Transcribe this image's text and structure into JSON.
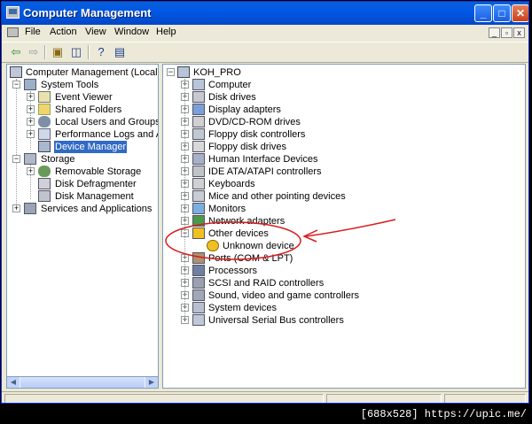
{
  "window": {
    "title": "Computer Management",
    "accent": "#0058e6"
  },
  "menu": {
    "items": [
      "File",
      "Action",
      "View",
      "Window",
      "Help"
    ]
  },
  "toolbar": {
    "buttons": [
      "back-icon",
      "forward-icon",
      "up-folder-icon",
      "show-hide-tree-icon",
      "help-icon",
      "properties-icon"
    ]
  },
  "left_tree": {
    "root": "Computer Management (Local)",
    "system_tools": "System Tools",
    "event_viewer": "Event Viewer",
    "shared_folders": "Shared Folders",
    "local_users": "Local Users and Groups",
    "perf_logs": "Performance Logs and Alerts",
    "device_manager": "Device Manager",
    "storage": "Storage",
    "removable_storage": "Removable Storage",
    "disk_defrag": "Disk Defragmenter",
    "disk_management": "Disk Management",
    "services_apps": "Services and Applications"
  },
  "device_tree": {
    "computer_name": "KOH_PRO",
    "categories": [
      "Computer",
      "Disk drives",
      "Display adapters",
      "DVD/CD-ROM drives",
      "Floppy disk controllers",
      "Floppy disk drives",
      "Human Interface Devices",
      "IDE ATA/ATAPI controllers",
      "Keyboards",
      "Mice and other pointing devices",
      "Monitors",
      "Network adapters",
      "Other devices",
      "Ports (COM & LPT)",
      "Processors",
      "SCSI and RAID controllers",
      "Sound, video and game controllers",
      "System devices",
      "Universal Serial Bus controllers"
    ],
    "unknown_device": "Unknown device"
  },
  "annotation": {
    "color": "#d81c1c"
  },
  "watermark": "[688x528] https://upic.me/"
}
